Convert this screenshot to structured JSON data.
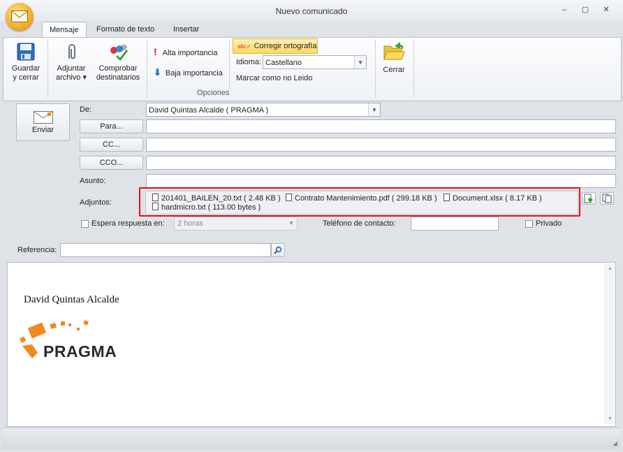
{
  "window": {
    "title": "Nuevo comunicado",
    "controls": [
      "–",
      "▢",
      "✕"
    ]
  },
  "tabs": [
    "Mensaje",
    "Formato de texto",
    "Insertar"
  ],
  "ribbon": {
    "save_close": {
      "line1": "Guardar",
      "line2": "y cerrar"
    },
    "attach": {
      "line1": "Adjuntar",
      "line2": "archivo ▾"
    },
    "check_recipients": {
      "line1": "Comprobar",
      "line2": "destinatarios"
    },
    "high_importance": "Alta importancia",
    "low_importance": "Baja importancia",
    "spellcheck": "Corregir ortografía",
    "language_label": "Idioma:",
    "language_value": "Castellano",
    "mark_unread": "Marcar como no Leido",
    "group_options": "Opciones",
    "close": "Cerrar"
  },
  "form": {
    "send": "Enviar",
    "from_label": "De:",
    "from_value": "David Quintas Alcalde ( PRAGMA )",
    "to_button": "Para...",
    "cc_button": "CC...",
    "bcc_button": "CCO...",
    "subject_label": "Asunto:",
    "attachments_label": "Adjuntos:",
    "attachments": [
      "201401_BAILEN_20.txt ( 2.48 KB )",
      "Contrato Mantenimiento.pdf ( 299.18 KB )",
      "Document.xlsx ( 8.17 KB )",
      "hardmicro.txt ( 113.00 bytes )"
    ],
    "await_reply_label": "Espera respuesta en:",
    "await_reply_value": "2 horas",
    "contact_phone_label": "Teléfono de contacto:",
    "private_label": "Privado",
    "reference_label": "Referencia:"
  },
  "body": {
    "signature_name": "David Quintas Alcalde",
    "logo_text": "PRAGMA"
  },
  "colors": {
    "accent_orange": "#f08a1c",
    "highlight_red": "#e0101e"
  }
}
